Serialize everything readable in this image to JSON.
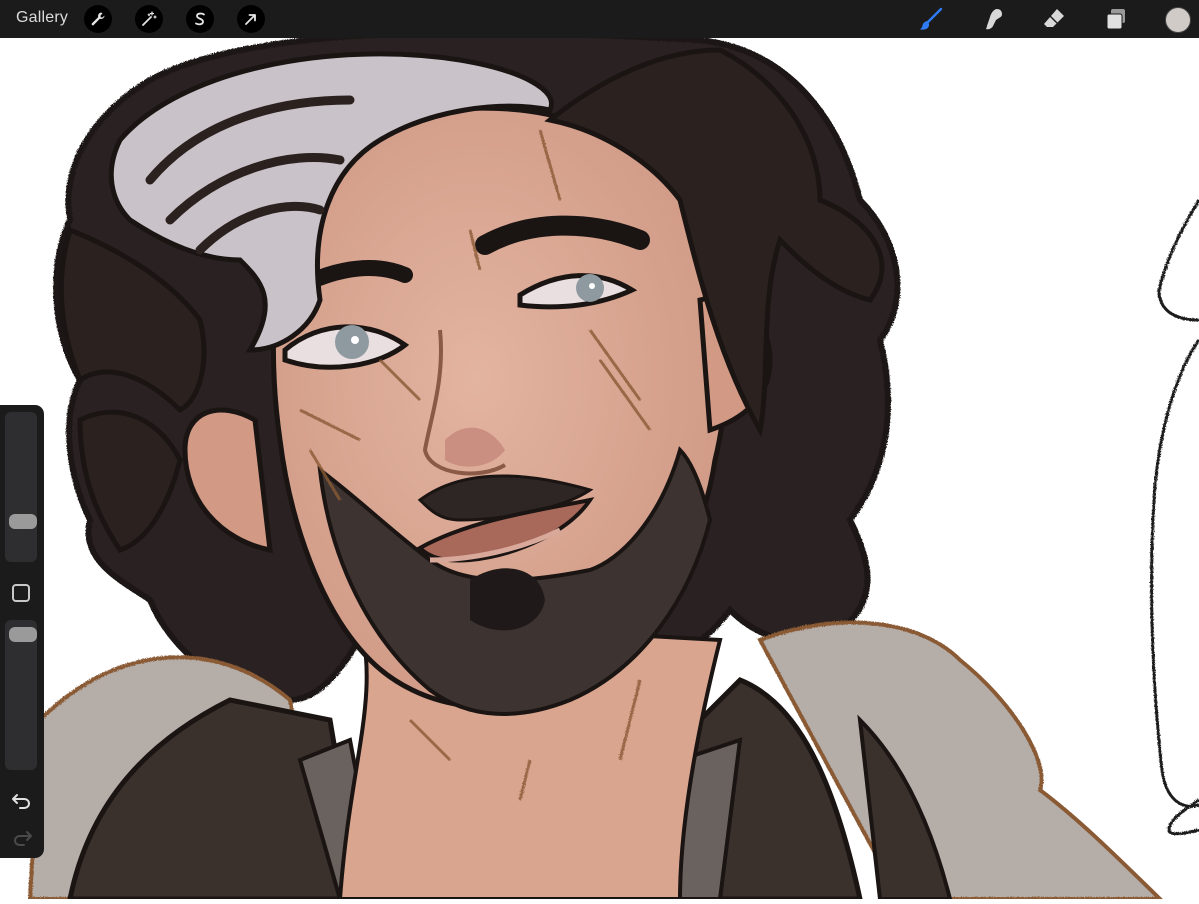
{
  "topbar": {
    "gallery_label": "Gallery",
    "left_tools": [
      {
        "name": "actions",
        "icon": "wrench-icon"
      },
      {
        "name": "adjustments",
        "icon": "magic-wand-icon"
      },
      {
        "name": "selection",
        "icon": "selection-s-icon"
      },
      {
        "name": "transform",
        "icon": "arrow-cursor-icon"
      }
    ],
    "right_tools": [
      {
        "name": "brush",
        "icon": "brush-icon",
        "active": true
      },
      {
        "name": "smudge",
        "icon": "smudge-icon"
      },
      {
        "name": "eraser",
        "icon": "eraser-icon"
      },
      {
        "name": "layers",
        "icon": "layers-icon"
      }
    ],
    "current_color": "#d1cbc8",
    "accent_color": "#2d7cf6"
  },
  "sidebar": {
    "brush_size_level": 0.72,
    "opacity_level": 0.08,
    "icons": [
      "modifier-square-icon",
      "undo-icon",
      "redo-icon"
    ]
  },
  "canvas": {
    "content": "illustration",
    "palette": {
      "hair_dark": "#2b2220",
      "hair_gray": "#c9c2c8",
      "skin": "#d9a58f",
      "skin_shadow": "#c48a75",
      "fur": "#b4ada8",
      "jacket": "#3a302c",
      "shirt": "#6a625f",
      "sketch_line": "#8a5a36"
    }
  }
}
